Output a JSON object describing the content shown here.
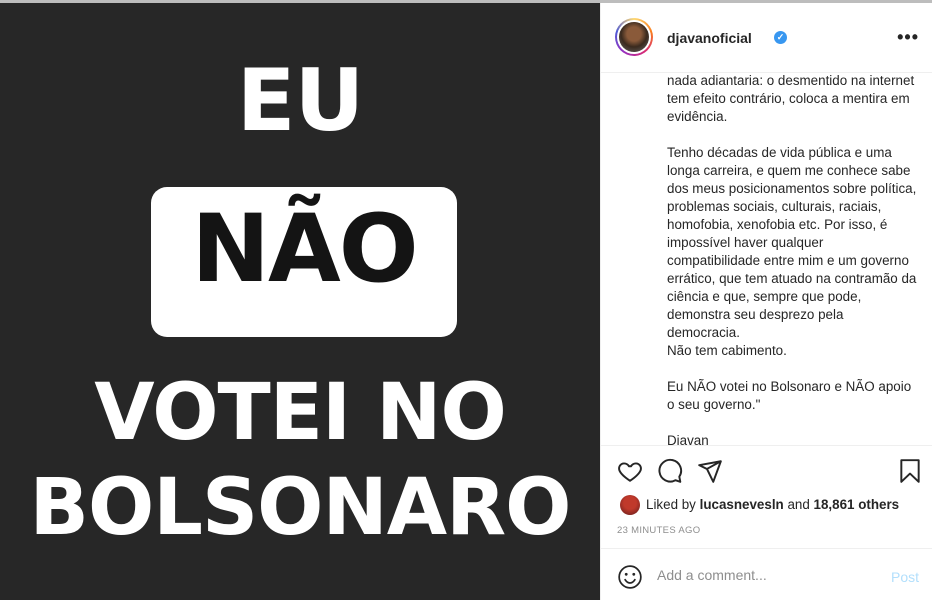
{
  "post_image": {
    "line1": "EU",
    "line2": "NÃO",
    "line3": "VOTEI NO",
    "line4": "BOLSONARO"
  },
  "header": {
    "username": "djavanoficial",
    "verified_mark": "✓",
    "more_label": "•••"
  },
  "caption": {
    "paragraphs": [
      "nada adiantaria: o desmentido na internet tem efeito contrário, coloca a mentira em evidência.",
      "Tenho décadas de vida pública e uma longa carreira, e quem me conhece sabe dos meus posicionamentos sobre política, problemas sociais, culturais, raciais, homofobia, xenofobia etc. Por isso, é impossível haver qualquer compatibilidade entre mim e um governo errático, que tem atuado na contramão da ciência e que, sempre que pode, demonstra seu desprezo pela democracia.\nNão tem cabimento.",
      "Eu NÃO votei no Bolsonaro e NÃO apoio o seu governo.\"",
      "Djavan"
    ]
  },
  "likes": {
    "prefix": "Liked by ",
    "user": "lucasnevesln",
    "middle": " and ",
    "count": "18,861 others"
  },
  "timestamp": "23 MINUTES AGO",
  "comment": {
    "placeholder": "Add a comment...",
    "post_label": "Post"
  },
  "colors": {
    "image_bg": "#272727",
    "verified": "#3897f0",
    "post_disabled": "#b2dffc"
  }
}
